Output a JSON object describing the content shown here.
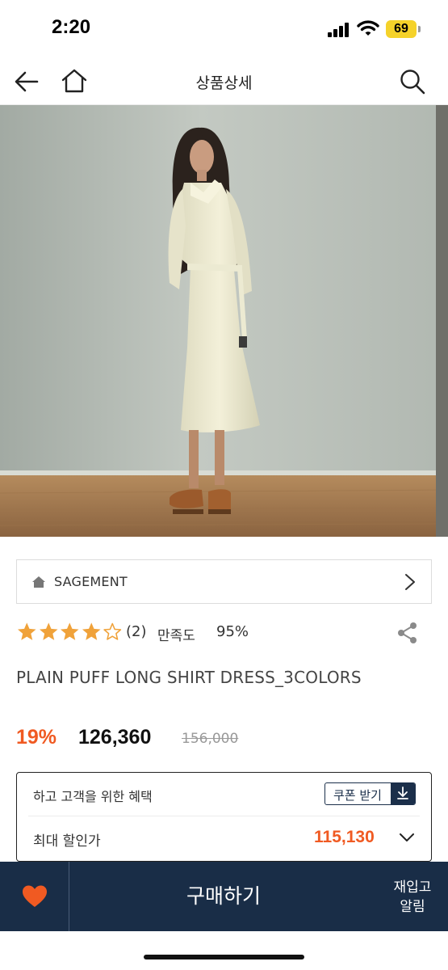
{
  "status_bar": {
    "time": "2:20",
    "battery": "69"
  },
  "nav": {
    "title": "상품상세",
    "icons": [
      "back-arrow-icon",
      "home-icon",
      "search-icon"
    ]
  },
  "hero": {
    "description_icon": "product-photo"
  },
  "brand": {
    "name": "SAGEMENT",
    "icon": "home-icon"
  },
  "rating": {
    "stars_filled": 4,
    "stars_total": 5,
    "count": "(2)",
    "satisfaction_label": "만족도",
    "satisfaction_value": "95%",
    "star_color": "#f0a23a"
  },
  "product": {
    "name": "PLAIN PUFF LONG SHIRT DRESS_3COLORS",
    "discount": "19%",
    "price": "126,360",
    "original_price": "156,000"
  },
  "benefit": {
    "title": "하고 고객을 위한 혜택",
    "coupon_button": "쿠폰 받기",
    "max_label": "최대 할인가",
    "max_price": "115,130"
  },
  "bottom_bar": {
    "buy_label": "구매하기",
    "restock_label": "재입고\n알림",
    "bar_color": "#192d47",
    "heart_color": "#f05a22"
  },
  "colors": {
    "accent": "#f05a22",
    "navy": "#192d47"
  }
}
